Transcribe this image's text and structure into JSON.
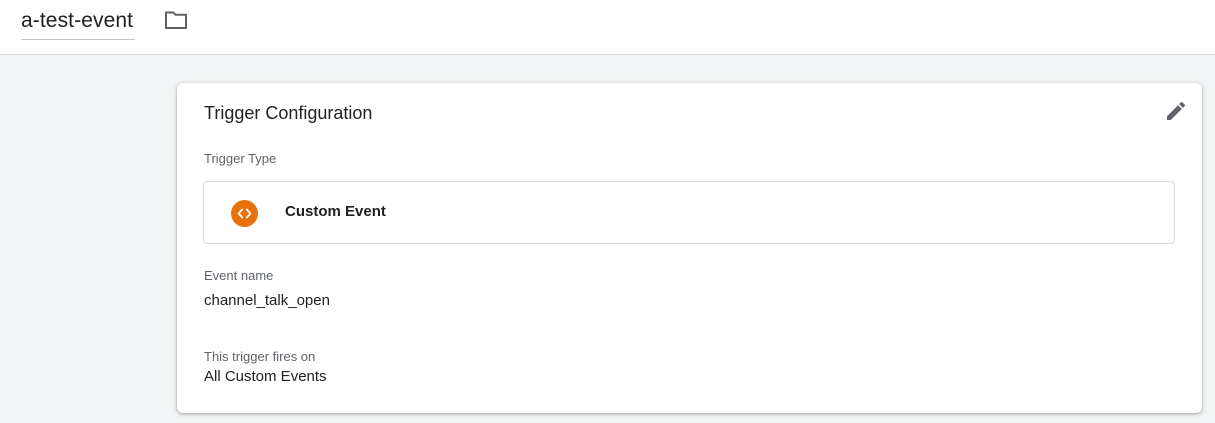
{
  "header": {
    "title": "a-test-event",
    "folder_icon": "folder-icon"
  },
  "card": {
    "title": "Trigger Configuration",
    "edit_icon": "pencil-icon",
    "trigger_type_label": "Trigger Type",
    "trigger_type": {
      "name": "Custom Event",
      "icon": "code-brackets-icon",
      "icon_color": "#e8710a"
    },
    "event_name_label": "Event name",
    "event_name_value": "channel_talk_open",
    "fires_on_label": "This trigger fires on",
    "fires_on_value": "All Custom Events"
  }
}
